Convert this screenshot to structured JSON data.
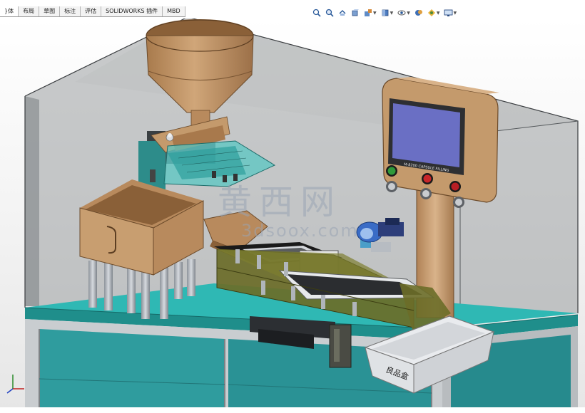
{
  "tabs": [
    "装配体",
    "布局",
    "草图",
    "标注",
    "评估",
    "SOLIDWORKS 插件",
    "MBD"
  ],
  "tab_display": [
    "}体",
    "布局",
    "草图",
    "标注",
    "评估",
    "SOLIDWORKS 插件",
    "MBD"
  ],
  "view_toolbar": [
    {
      "name": "zoom-to-fit-icon"
    },
    {
      "name": "zoom-to-area-icon"
    },
    {
      "name": "previous-view-icon"
    },
    {
      "name": "section-view-icon"
    },
    {
      "name": "dynamic-annotation-icon"
    },
    {
      "name": "view-orientation-icon"
    },
    {
      "name": "display-style-icon"
    },
    {
      "name": "hide-show-items-icon"
    },
    {
      "name": "edit-appearance-icon"
    },
    {
      "name": "apply-scene-icon"
    },
    {
      "name": "view-settings-icon"
    }
  ],
  "model": {
    "hmi_label": "M-8200 CAPSULE FILLING",
    "reject_bin_label": "良品盒",
    "watermark_cn": "黄西网",
    "watermark_url": "3dsoox.com"
  },
  "colors": {
    "enclosure": "#8f9294",
    "table_top": "#2fb8b4",
    "cabinet": "#3a9fa2",
    "bronze": "#c49a6c",
    "olive": "#6b6d28",
    "screen": "#6a6fc4"
  }
}
